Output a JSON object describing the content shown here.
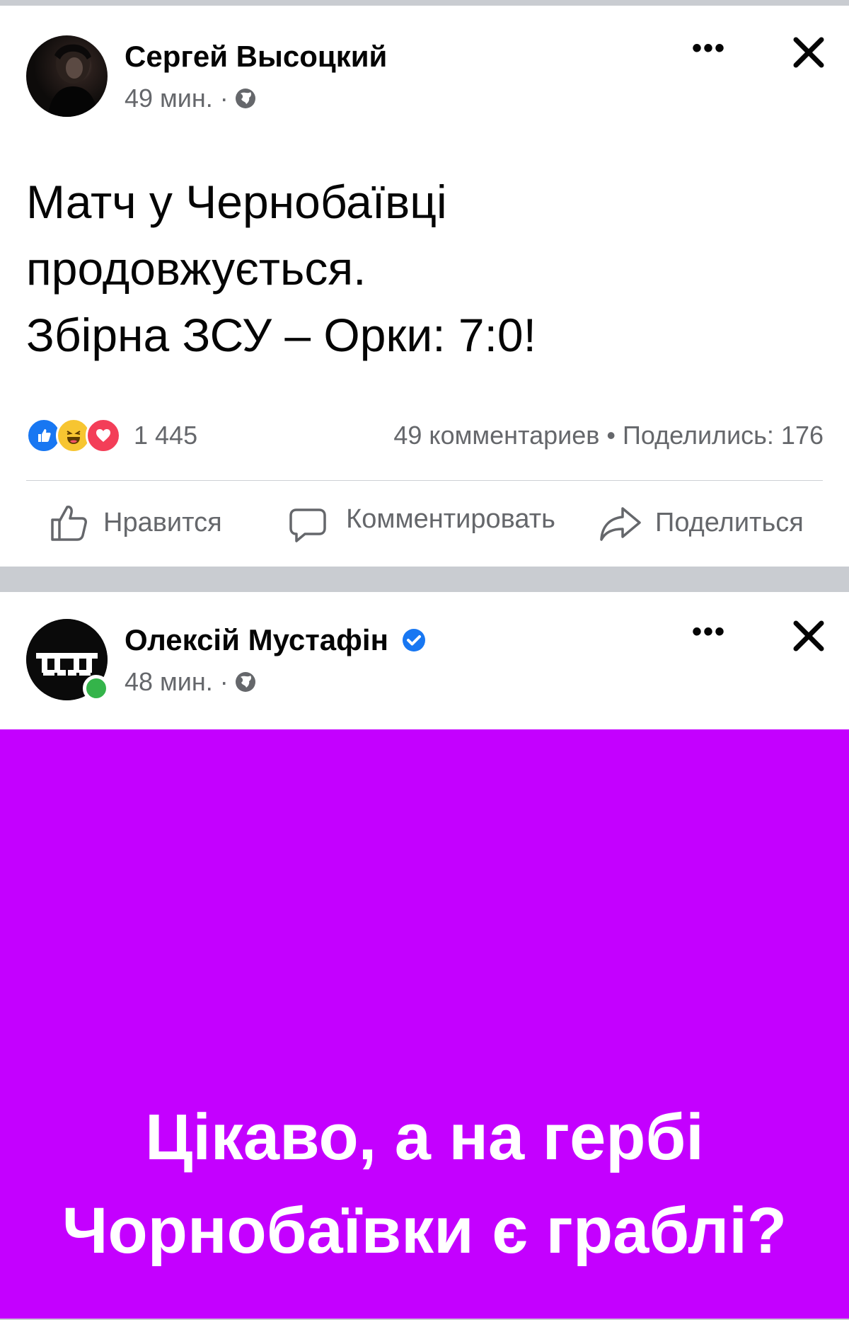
{
  "post1": {
    "author": "Сергей Высоцкий",
    "time": "49 мин. ·",
    "privacy_icon": "globe-icon",
    "more_icon": "more-icon",
    "close_icon": "close-icon",
    "text_lines": [
      "Матч у Чернобаївці",
      "продовжується.",
      "Збірна ЗСУ – Орки: 7:0!"
    ],
    "reactions": {
      "icons": [
        "like-reaction-icon",
        "haha-reaction-icon",
        "love-reaction-icon"
      ],
      "count": "1 445"
    },
    "stats": "49 комментариев • Поделились: 176",
    "actions": {
      "like": "Нравится",
      "comment": "Комментировать",
      "share": "Поделиться"
    }
  },
  "post2": {
    "author": "Олексій Мустафін",
    "verified_icon": "verified-badge-icon",
    "time": "48 мин. ·",
    "privacy_icon": "globe-icon",
    "more_icon": "more-icon",
    "close_icon": "close-icon",
    "online_status": "online-indicator",
    "image_text_lines": [
      "Цікаво, а на гербі",
      "Чорнобаївки є граблі?"
    ],
    "image_background": "#c400ff"
  },
  "colors": {
    "separator": "#c9ccd1",
    "secondary_text": "#65676b",
    "facebook_blue": "#1877f2"
  }
}
